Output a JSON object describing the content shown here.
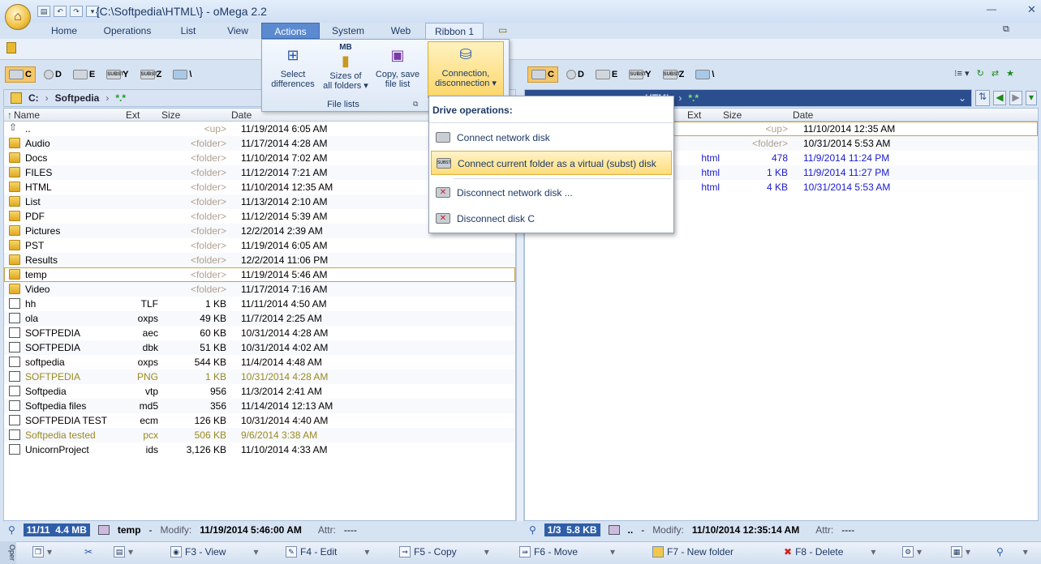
{
  "window": {
    "title": "{C:\\Softpedia\\HTML\\} - oMega 2.2",
    "min_glyph": "—",
    "close_glyph": "✕"
  },
  "tabs": [
    "Home",
    "Operations",
    "List",
    "View",
    "Actions",
    "System",
    "Web",
    "Ribbon 1"
  ],
  "ribbon_popup": {
    "buttons": [
      {
        "label1": "Select",
        "label2": "differences",
        "icon": "compare-icon"
      },
      {
        "label0": "MB",
        "label1": "Sizes of",
        "label2": "all folders ▾",
        "icon": "folder-size-icon"
      },
      {
        "label1": "Copy, save",
        "label2": "file list",
        "icon": "floppy-icon"
      }
    ],
    "group_label": "File lists",
    "connect": {
      "label1": "Connection,",
      "label2": "disconnection ▾"
    }
  },
  "left_drives": [
    {
      "letter": "C",
      "selected": true,
      "icon_text": ""
    },
    {
      "letter": "D",
      "selected": false,
      "icon_text": ""
    },
    {
      "letter": "E",
      "selected": false,
      "icon_text": ""
    },
    {
      "letter": "Y",
      "selected": false,
      "icon_text": "SUBST"
    },
    {
      "letter": "Z",
      "selected": false,
      "icon_text": "SUBST"
    },
    {
      "letter": "\\",
      "selected": false,
      "icon_text": ""
    }
  ],
  "right_drives": [
    {
      "letter": "C",
      "selected": true,
      "icon_text": ""
    },
    {
      "letter": "D",
      "selected": false,
      "icon_text": ""
    },
    {
      "letter": "E",
      "selected": false,
      "icon_text": ""
    },
    {
      "letter": "Y",
      "selected": false,
      "icon_text": "SUBST"
    },
    {
      "letter": "Z",
      "selected": false,
      "icon_text": "SUBST"
    },
    {
      "letter": "\\",
      "selected": false,
      "icon_text": ""
    }
  ],
  "left_path": {
    "drive": "C:",
    "folder": "Softpedia",
    "filter": "*.*"
  },
  "right_path": {
    "folder": "HTML",
    "filter": "*.*"
  },
  "columns": {
    "name": "Name",
    "ext": "Ext",
    "size": "Size",
    "date": "Date"
  },
  "left_files": [
    {
      "name": "..",
      "ext": "",
      "size": "<up>",
      "date": "11/19/2014 6:05 AM",
      "type": "up",
      "style": "normal"
    },
    {
      "name": "Audio",
      "ext": "",
      "size": "<folder>",
      "date": "11/17/2014 4:28 AM",
      "type": "folder",
      "style": "normal"
    },
    {
      "name": "Docs",
      "ext": "",
      "size": "<folder>",
      "date": "11/10/2014 7:02 AM",
      "type": "folder",
      "style": "normal"
    },
    {
      "name": "FILES",
      "ext": "",
      "size": "<folder>",
      "date": "11/12/2014 7:21 AM",
      "type": "folder",
      "style": "normal"
    },
    {
      "name": "HTML",
      "ext": "",
      "size": "<folder>",
      "date": "11/10/2014 12:35 AM",
      "type": "folder",
      "style": "normal"
    },
    {
      "name": "List",
      "ext": "",
      "size": "<folder>",
      "date": "11/13/2014 2:10 AM",
      "type": "folder",
      "style": "normal"
    },
    {
      "name": "PDF",
      "ext": "",
      "size": "<folder>",
      "date": "11/12/2014 5:39 AM",
      "type": "folder",
      "style": "normal"
    },
    {
      "name": "Pictures",
      "ext": "",
      "size": "<folder>",
      "date": "12/2/2014 2:39 AM",
      "type": "folder",
      "style": "normal"
    },
    {
      "name": "PST",
      "ext": "",
      "size": "<folder>",
      "date": "11/19/2014 6:05 AM",
      "type": "folder",
      "style": "normal"
    },
    {
      "name": "Results",
      "ext": "",
      "size": "<folder>",
      "date": "12/2/2014 11:06 PM",
      "type": "folder",
      "style": "normal"
    },
    {
      "name": "temp",
      "ext": "",
      "size": "<folder>",
      "date": "11/19/2014 5:46 AM",
      "type": "folder",
      "style": "normal",
      "focused": true
    },
    {
      "name": "Video",
      "ext": "",
      "size": "<folder>",
      "date": "11/17/2014 7:16 AM",
      "type": "folder",
      "style": "normal"
    },
    {
      "name": "hh",
      "ext": "TLF",
      "size": "1 KB",
      "date": "11/11/2014 4:50 AM",
      "type": "file",
      "style": "normal"
    },
    {
      "name": "ola",
      "ext": "oxps",
      "size": "49 KB",
      "date": "11/7/2014 2:25 AM",
      "type": "file",
      "style": "normal"
    },
    {
      "name": "SOFTPEDIA",
      "ext": "aec",
      "size": "60 KB",
      "date": "10/31/2014 4:28 AM",
      "type": "file",
      "style": "normal"
    },
    {
      "name": "SOFTPEDIA",
      "ext": "dbk",
      "size": "51 KB",
      "date": "10/31/2014 4:02 AM",
      "type": "file",
      "style": "normal"
    },
    {
      "name": "softpedia",
      "ext": "oxps",
      "size": "544 KB",
      "date": "11/4/2014 4:48 AM",
      "type": "file",
      "style": "normal"
    },
    {
      "name": "SOFTPEDIA",
      "ext": "PNG",
      "size": "1 KB",
      "date": "10/31/2014 4:28 AM",
      "type": "file",
      "style": "olive"
    },
    {
      "name": "Softpedia",
      "ext": "vtp",
      "size": "956",
      "date": "11/3/2014 2:41 AM",
      "type": "file",
      "style": "normal"
    },
    {
      "name": "Softpedia files",
      "ext": "md5",
      "size": "356",
      "date": "11/14/2014 12:13 AM",
      "type": "file",
      "style": "normal"
    },
    {
      "name": "SOFTPEDIA TEST",
      "ext": "ecm",
      "size": "126 KB",
      "date": "10/31/2014 4:40 AM",
      "type": "file",
      "style": "normal"
    },
    {
      "name": "Softpedia tested",
      "ext": "pcx",
      "size": "506 KB",
      "date": "9/6/2014 3:38 AM",
      "type": "file",
      "style": "olive"
    },
    {
      "name": "UnicornProject",
      "ext": "ids",
      "size": "3,126 KB",
      "date": "11/10/2014 4:33 AM",
      "type": "file",
      "style": "normal"
    }
  ],
  "right_files": [
    {
      "ext": "",
      "size": "<up>",
      "date": "11/10/2014 12:35 AM",
      "style": "normal",
      "focused": true
    },
    {
      "ext": "",
      "size": "<folder>",
      "date": "10/31/2014 5:53 AM",
      "style": "normal"
    },
    {
      "ext": "html",
      "size": "478",
      "date": "11/9/2014 11:24 PM",
      "style": "blue"
    },
    {
      "ext": "html",
      "size": "1 KB",
      "date": "11/9/2014 11:27 PM",
      "style": "blue"
    },
    {
      "ext": "html",
      "size": "4 KB",
      "date": "10/31/2014 5:53 AM",
      "style": "blue"
    }
  ],
  "drive_menu": {
    "title": "Drive operations:",
    "items": [
      {
        "label": "Connect network disk",
        "hover": false
      },
      {
        "label": "Connect current folder as a virtual (subst) disk",
        "hover": true
      },
      {
        "label": "Disconnect network disk ...",
        "hover": false
      },
      {
        "label": "Disconnect disk C",
        "hover": false
      }
    ]
  },
  "left_status": {
    "count": "11/11",
    "size": "4.4 MB",
    "name": "temp",
    "dash": "-",
    "modify_label": "Modify:",
    "modify": "11/19/2014 5:46:00 AM",
    "attr_label": "Attr:",
    "attr": "----"
  },
  "right_status": {
    "count": "1/3",
    "size": "5.8 KB",
    "name": "..",
    "dash": "-",
    "modify_label": "Modify:",
    "modify": "11/10/2014 12:35:14 AM",
    "attr_label": "Attr:",
    "attr": "----"
  },
  "fkeys": [
    "F3 - View",
    "F4 - Edit",
    "F5 - Copy",
    "F6 - Move",
    "F7 - New folder",
    "F8 - Delete"
  ],
  "side_tab": "Oper"
}
